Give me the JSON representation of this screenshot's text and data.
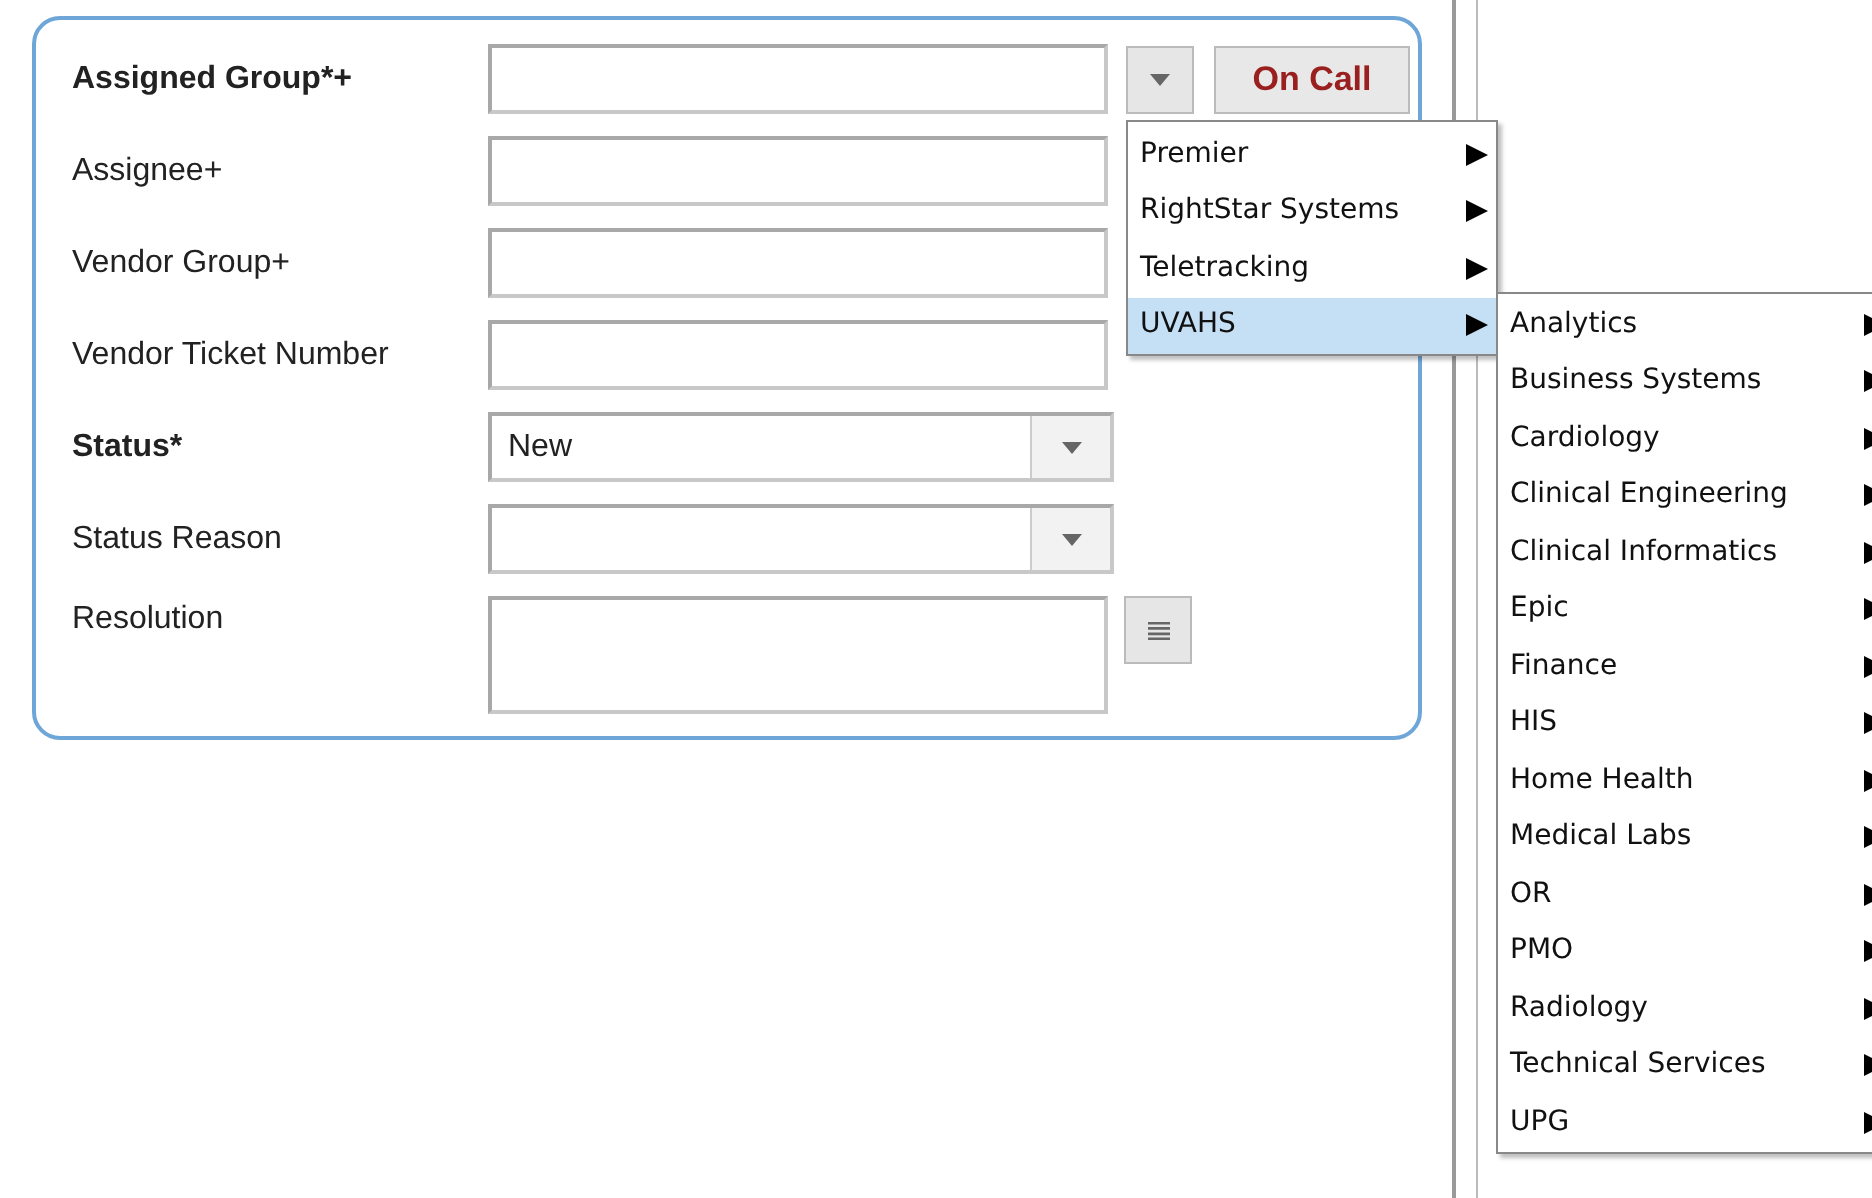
{
  "form": {
    "fields": [
      {
        "label": "Assigned Group*+",
        "bold": true,
        "kind": "text",
        "lookup_button": true,
        "action": "On Call"
      },
      {
        "label": "Assignee+",
        "bold": false,
        "kind": "text"
      },
      {
        "label": "Vendor Group+",
        "bold": false,
        "kind": "text"
      },
      {
        "label": "Vendor Ticket Number",
        "bold": false,
        "kind": "text"
      },
      {
        "label": "Status*",
        "bold": true,
        "kind": "select",
        "value": "New"
      },
      {
        "label": "Status Reason",
        "bold": false,
        "kind": "select"
      },
      {
        "label": "Resolution",
        "bold": false,
        "kind": "textarea",
        "expand_button": true
      }
    ]
  },
  "menu": {
    "items": [
      {
        "label": "Premier",
        "submenu": true,
        "selected": false
      },
      {
        "label": "RightStar Systems",
        "submenu": true,
        "selected": false
      },
      {
        "label": "Teletracking",
        "submenu": true,
        "selected": false
      },
      {
        "label": "UVAHS",
        "submenu": true,
        "selected": true
      }
    ]
  },
  "submenu": {
    "items": [
      {
        "label": "Analytics",
        "submenu": true,
        "selected": false
      },
      {
        "label": "Business Systems",
        "submenu": true,
        "selected": false
      },
      {
        "label": "Cardiology",
        "submenu": true,
        "selected": false
      },
      {
        "label": "Clinical Engineering",
        "submenu": true,
        "selected": false
      },
      {
        "label": "Clinical Informatics",
        "submenu": true,
        "selected": false
      },
      {
        "label": "Epic",
        "submenu": true,
        "selected": false
      },
      {
        "label": "Finance",
        "submenu": true,
        "selected": false
      },
      {
        "label": "HIS",
        "submenu": true,
        "selected": false
      },
      {
        "label": "Home Health",
        "submenu": true,
        "selected": false
      },
      {
        "label": "Medical Labs",
        "submenu": true,
        "selected": false
      },
      {
        "label": "OR",
        "submenu": true,
        "selected": false
      },
      {
        "label": "PMO",
        "submenu": true,
        "selected": false
      },
      {
        "label": "Radiology",
        "submenu": true,
        "selected": false
      },
      {
        "label": "Technical Services",
        "submenu": true,
        "selected": false
      },
      {
        "label": "UPG",
        "submenu": true,
        "selected": false
      }
    ]
  }
}
